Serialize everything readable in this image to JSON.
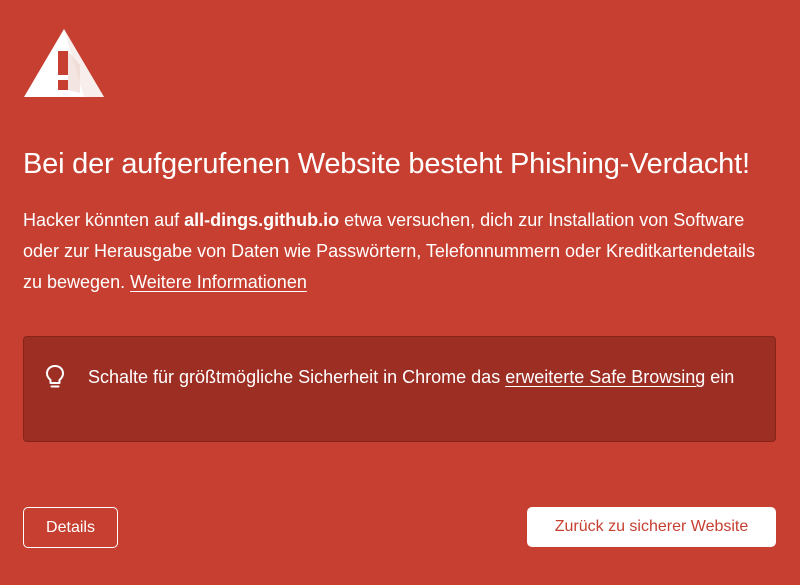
{
  "page": {
    "heading": "Bei der aufgerufenen Website besteht Phishing-Verdacht!",
    "explanation": {
      "part1": "Hacker könnten auf ",
      "site": "all-dings.github.io",
      "part2": " etwa versuchen, dich zur Installation von Software oder zur Herausgabe von Daten wie Passwörtern, Telefonnummern oder Kreditkartendetails zu bewegen. ",
      "learn_more_link": "Weitere Informationen"
    },
    "safe_browsing": {
      "text_before": "Schalte für größtmögliche Sicherheit in Chrome das ",
      "link": "erweiterte Safe Browsing",
      "text_after": " ein"
    },
    "buttons": {
      "details": "Details",
      "back": "Zurück zu sicherer Website"
    }
  },
  "icons": {
    "warning": "warning-triangle-icon",
    "tip": "lightbulb-icon"
  },
  "colors": {
    "background": "#c63f30",
    "panel": "#9d2e24",
    "text": "#ffffff",
    "primary_button_text": "#c63f30"
  }
}
